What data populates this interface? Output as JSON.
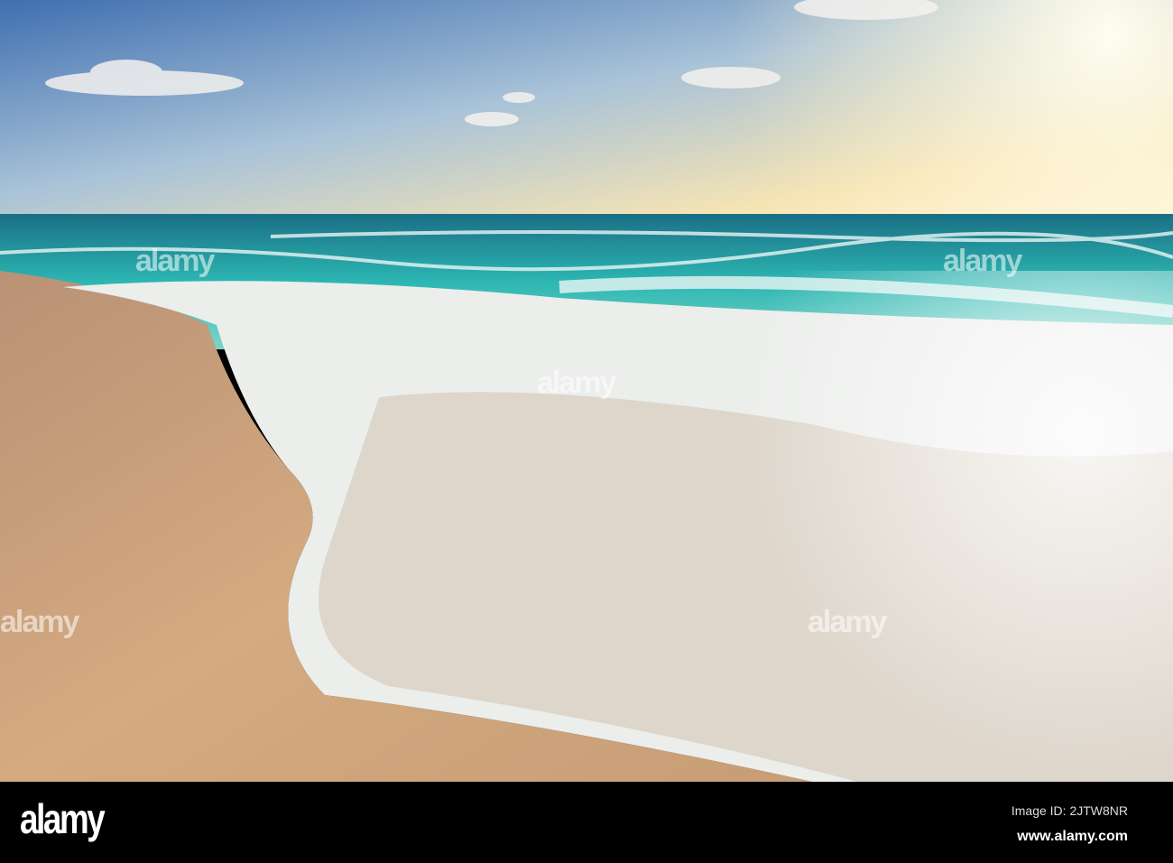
{
  "watermark": {
    "logo": "alamy",
    "image_id": "Image ID: 2JTW8NR",
    "site": "www.alamy.com"
  },
  "colors": {
    "sky_top": "#4a78b8",
    "sky_horizon": "#f4e0b0",
    "sea": "#2fb5b0",
    "sand": "#c9a07a",
    "foam": "#f2f4f4"
  }
}
